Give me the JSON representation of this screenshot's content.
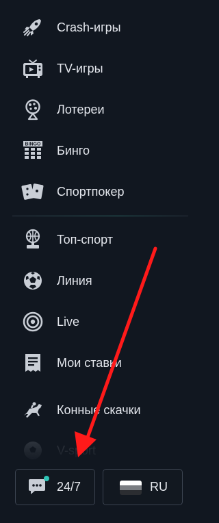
{
  "menu": {
    "items": [
      {
        "label": "Crash-игры",
        "icon": "rocket-icon"
      },
      {
        "label": "TV-игры",
        "icon": "tv-icon"
      },
      {
        "label": "Лотереи",
        "icon": "lottery-icon"
      },
      {
        "label": "Бинго",
        "icon": "bingo-icon"
      },
      {
        "label": "Спортпокер",
        "icon": "cards-icon"
      },
      {
        "label": "Топ-спорт",
        "icon": "trophy-icon"
      },
      {
        "label": "Линия",
        "icon": "soccer-ball-icon"
      },
      {
        "label": "Live",
        "icon": "live-icon"
      },
      {
        "label": "Мои ставки",
        "icon": "receipt-icon"
      },
      {
        "label": "Конные скачки",
        "icon": "horse-racing-icon"
      },
      {
        "label": "V-sport",
        "icon": "v-sport-icon"
      }
    ]
  },
  "icons": {
    "bingo_text": "BINGO"
  },
  "footer": {
    "support_label": "24/7",
    "language_label": "RU"
  },
  "colors": {
    "background": "#111720",
    "text": "#e3e6ec",
    "icon": "#c9ced6",
    "accent_dot": "#2ec4b6",
    "annotation_arrow": "#ff1a1a"
  }
}
